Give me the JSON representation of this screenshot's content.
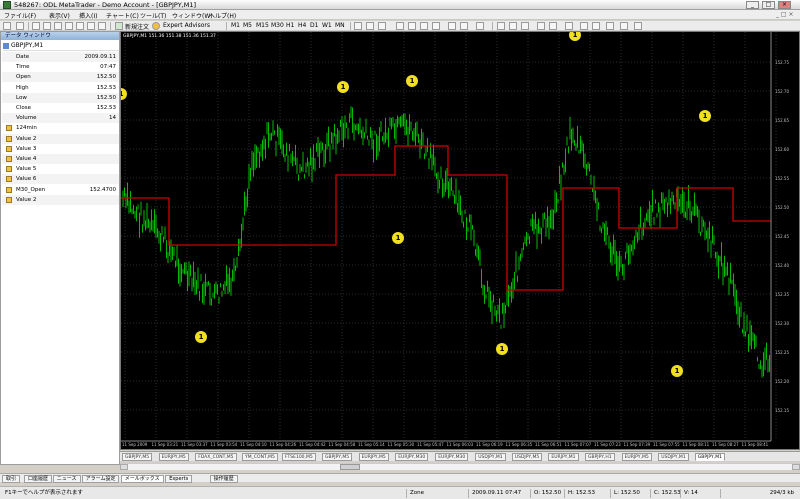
{
  "window": {
    "title": "548267: ODL MetaTrader - Demo Account - [GBPJPY,M1]",
    "min": "_",
    "max": "□",
    "close": "×"
  },
  "menu": [
    "ファイル(F)",
    "表示(V)",
    "挿入(I)",
    "チャート(C)",
    "ツール(T)",
    "ウィンドウ(W)",
    "ヘルプ(H)"
  ],
  "toolbar": {
    "new_order": "新規注文",
    "expert_advisors": "Expert Advisors",
    "timeframes": [
      "M1",
      "M5",
      "M15",
      "M30",
      "H1",
      "H4",
      "D1",
      "W1",
      "MN"
    ]
  },
  "data_window": {
    "title": "データ ウィンドウ",
    "symbol": "GBPJPY,M1",
    "rows": [
      {
        "label": "Date",
        "value": "2009.09.11",
        "icon": false
      },
      {
        "label": "Time",
        "value": "07:47",
        "icon": false
      },
      {
        "label": "Open",
        "value": "152.50",
        "icon": false
      },
      {
        "label": "High",
        "value": "152.53",
        "icon": false
      },
      {
        "label": "Low",
        "value": "152.50",
        "icon": false
      },
      {
        "label": "Close",
        "value": "152.53",
        "icon": false
      },
      {
        "label": "Volume",
        "value": "14",
        "icon": false
      },
      {
        "label": "124min",
        "value": "",
        "icon": true
      },
      {
        "label": "Value 2",
        "value": "",
        "icon": true
      },
      {
        "label": "Value 3",
        "value": "",
        "icon": true
      },
      {
        "label": "Value 4",
        "value": "",
        "icon": true
      },
      {
        "label": "Value 5",
        "value": "",
        "icon": true
      },
      {
        "label": "Value 6",
        "value": "",
        "icon": true
      },
      {
        "label": "M30_Open",
        "value": "152.4700",
        "icon": true
      },
      {
        "label": "Value 2",
        "value": "",
        "icon": true
      }
    ]
  },
  "chart": {
    "header": "GBPJPY,M1 151.36 151.38 151.36 151.37",
    "price_labels": [
      "152.75",
      "152.70",
      "152.65",
      "152.60",
      "152.55",
      "152.50",
      "152.45",
      "152.40",
      "152.35",
      "152.30",
      "152.25",
      "152.20",
      "152.15"
    ],
    "time_labels": [
      "11 Sep 2009",
      "11 Sep 03:21",
      "11 Sep 03:37",
      "11 Sep 03:54",
      "11 Sep 04:10",
      "11 Sep 04:26",
      "11 Sep 04:42",
      "11 Sep 04:58",
      "11 Sep 05:14",
      "11 Sep 05:30",
      "11 Sep 05:47",
      "11 Sep 06:03",
      "11 Sep 06:19",
      "11 Sep 06:35",
      "11 Sep 06:51",
      "11 Sep 07:07",
      "11 Sep 07:23",
      "11 Sep 07:39",
      "11 Sep 07:55",
      "11 Sep 08:11",
      "11 Sep 08:27",
      "11 Sep 08:41"
    ],
    "marker_glyph": "1",
    "colors": {
      "bg": "#000000",
      "bars": "#00d000",
      "line": "#d00000",
      "grid": "#2a2a2a",
      "marker": "#f0e020"
    }
  },
  "chart_tabs": [
    "GBPJPY,M5",
    "EURJPY,M5",
    "FDAX_CONT,M5",
    "YM_CONT,M5",
    "FTSE100,M5",
    "GBPJPY,M5",
    "EURJPY,M5",
    "EURJPY,M30",
    "EURJPY,M30",
    "USDJPY,M1",
    "USDJPY,M5",
    "EURJPY,M1",
    "GBPJPY,H1",
    "EURJPY,M5",
    "USDJPY,M1",
    "GBPJPY,M1"
  ],
  "terminal_tabs": [
    "取引",
    "口座履歴",
    "ニュース",
    "アラーム設定",
    "メールボックス",
    "Experts",
    "操作履歴"
  ],
  "terminal_selected": 4,
  "status": {
    "help": "F1キーでヘルプが表示されます",
    "profile": "Zone",
    "datetime": "2009.09.11 07:47",
    "open": "O: 152.50",
    "high": "H: 152.53",
    "low": "L: 152.50",
    "close": "C: 152.53",
    "volume": "V: 14",
    "traffic": "294/3 kb"
  }
}
